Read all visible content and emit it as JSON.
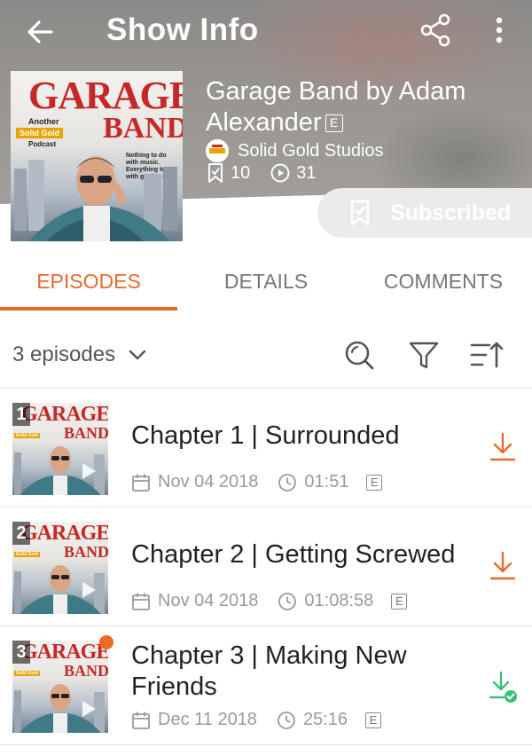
{
  "topbar": {
    "title": "Show Info"
  },
  "show": {
    "title": "Garage Band by Adam Alexander",
    "explicit_badge": "E",
    "studio": "Solid Gold Studios",
    "subscriber_count": "10",
    "play_count": "31",
    "subscribe_label": "Subscribed",
    "cover": {
      "title_line1": "GARAGE",
      "title_line2": "BAND",
      "another": "Another",
      "tag": "Solid Gold",
      "podcast": "Podcast",
      "tagline": "Nothing to do with music. Everything to do with getting over"
    }
  },
  "tabs": [
    {
      "label": "EPISODES",
      "active": true
    },
    {
      "label": "DETAILS",
      "active": false
    },
    {
      "label": "COMMENTS",
      "active": false
    }
  ],
  "toolbar": {
    "episode_count": "3 episodes"
  },
  "episodes": [
    {
      "number": "1",
      "title": "Chapter 1 | Surrounded",
      "date": "Nov 04 2018",
      "duration": "01:51",
      "badge": "E",
      "downloaded": false,
      "new": false
    },
    {
      "number": "2",
      "title": "Chapter 2 | Getting Screwed",
      "date": "Nov 04 2018",
      "duration": "01:08:58",
      "badge": "E",
      "downloaded": false,
      "new": false
    },
    {
      "number": "3",
      "title": "Chapter 3 | Making New Friends",
      "date": "Dec 11 2018",
      "duration": "25:16",
      "badge": "E",
      "downloaded": true,
      "new": true
    }
  ],
  "colors": {
    "accent": "#e66a2c",
    "downloaded": "#3dbf7a",
    "header_bg": "#9a9793"
  },
  "icons": {
    "back": "arrow-left-icon",
    "share": "share-icon",
    "more": "more-vertical-icon",
    "search": "search-icon",
    "filter": "filter-icon",
    "sort": "sort-icon",
    "download": "download-icon",
    "downloaded": "download-check-icon"
  }
}
